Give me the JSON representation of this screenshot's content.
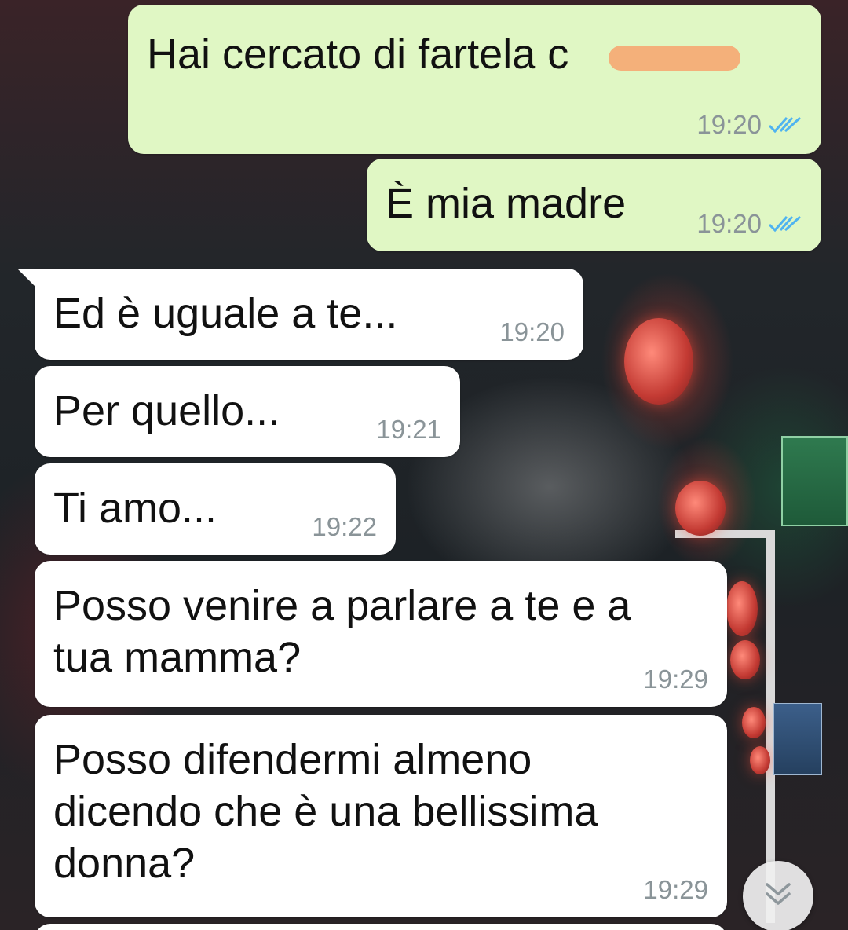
{
  "colors": {
    "outgoing_bubble": "#e0f7c4",
    "incoming_bubble": "#ffffff",
    "timestamp": "#8a9498",
    "read_ticks": "#4fb3f0"
  },
  "messages": [
    {
      "direction": "outgoing",
      "text": "Hai cercato di fartela c",
      "time": "19:20",
      "status": "read-double-tick",
      "redacted_tail": true
    },
    {
      "direction": "outgoing",
      "text": "È mia madre",
      "time": "19:20",
      "status": "read-double-tick"
    },
    {
      "direction": "incoming",
      "text": "Ed è uguale a te...",
      "time": "19:20"
    },
    {
      "direction": "incoming",
      "text": "Per quello...",
      "time": "19:21"
    },
    {
      "direction": "incoming",
      "text": "Ti amo...",
      "time": "19:22"
    },
    {
      "direction": "incoming",
      "text": "Posso venire a parlare a te e a\ntua mamma?",
      "time": "19:29"
    },
    {
      "direction": "incoming",
      "text": "Posso difendermi almeno\ndicendo che è una bellissima\ndonna?",
      "time": "19:29"
    }
  ],
  "scroll_button": {
    "icon": "double-chevron-down-icon"
  }
}
